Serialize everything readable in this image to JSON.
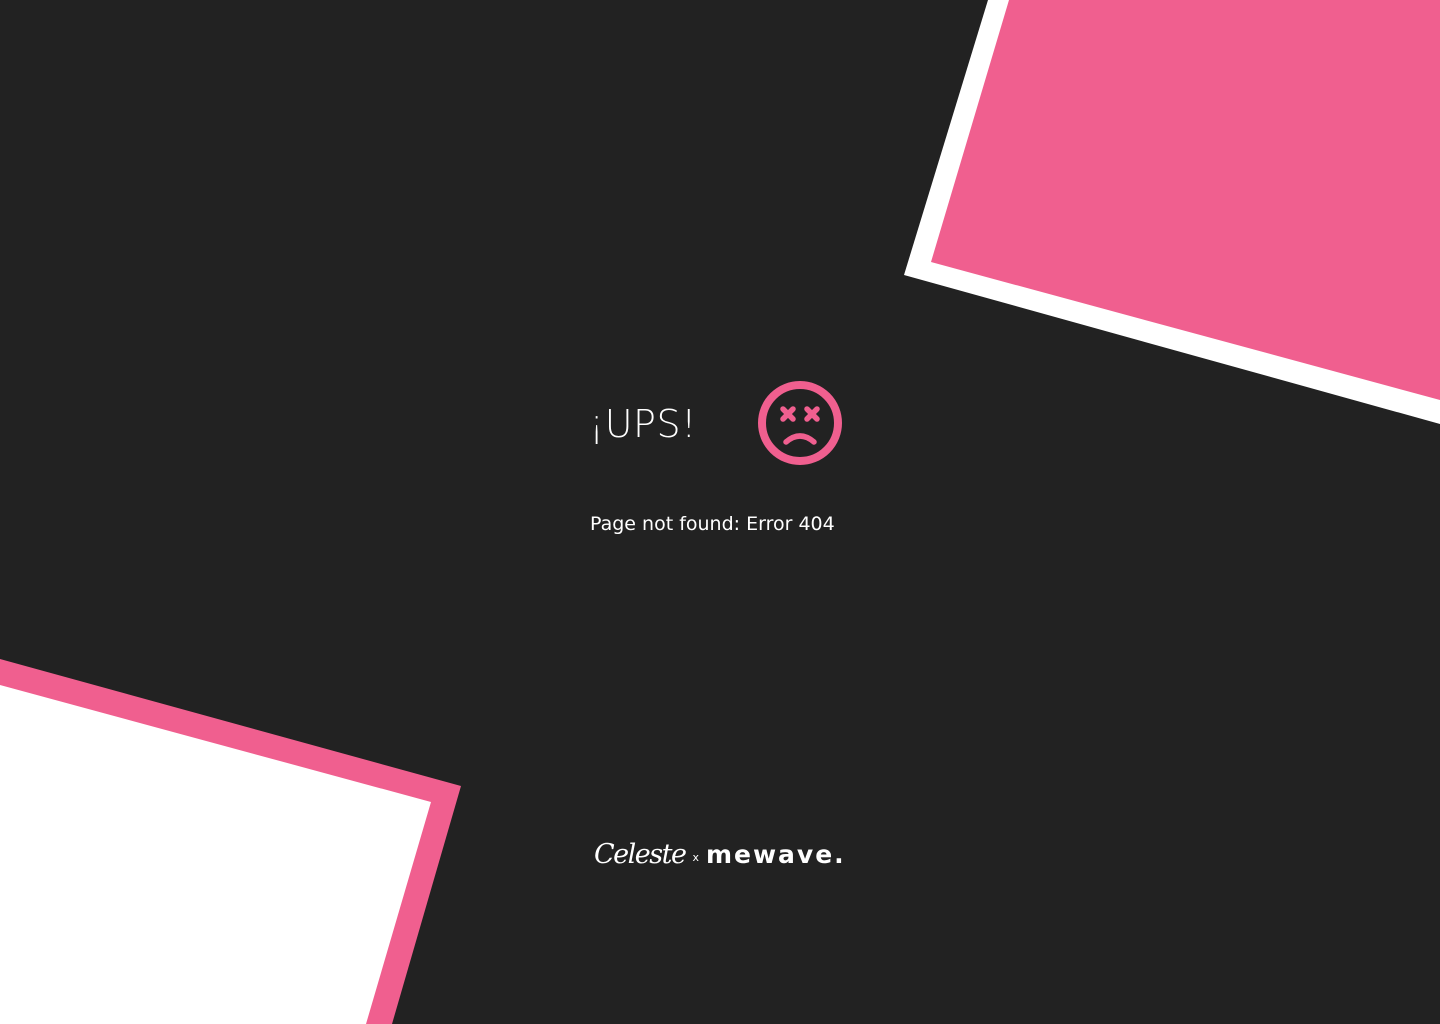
{
  "error": {
    "headline": "¡UPS!",
    "message": "Page not found: Error 404"
  },
  "footer": {
    "brand_primary": "Celeste",
    "separator": "x",
    "brand_secondary": "mewave."
  },
  "icons": {
    "status": "sad-dizzy-face-icon"
  },
  "colors": {
    "background": "#222222",
    "accent": "#f05f8f",
    "light": "#ffffff",
    "text": "#ffffff"
  }
}
